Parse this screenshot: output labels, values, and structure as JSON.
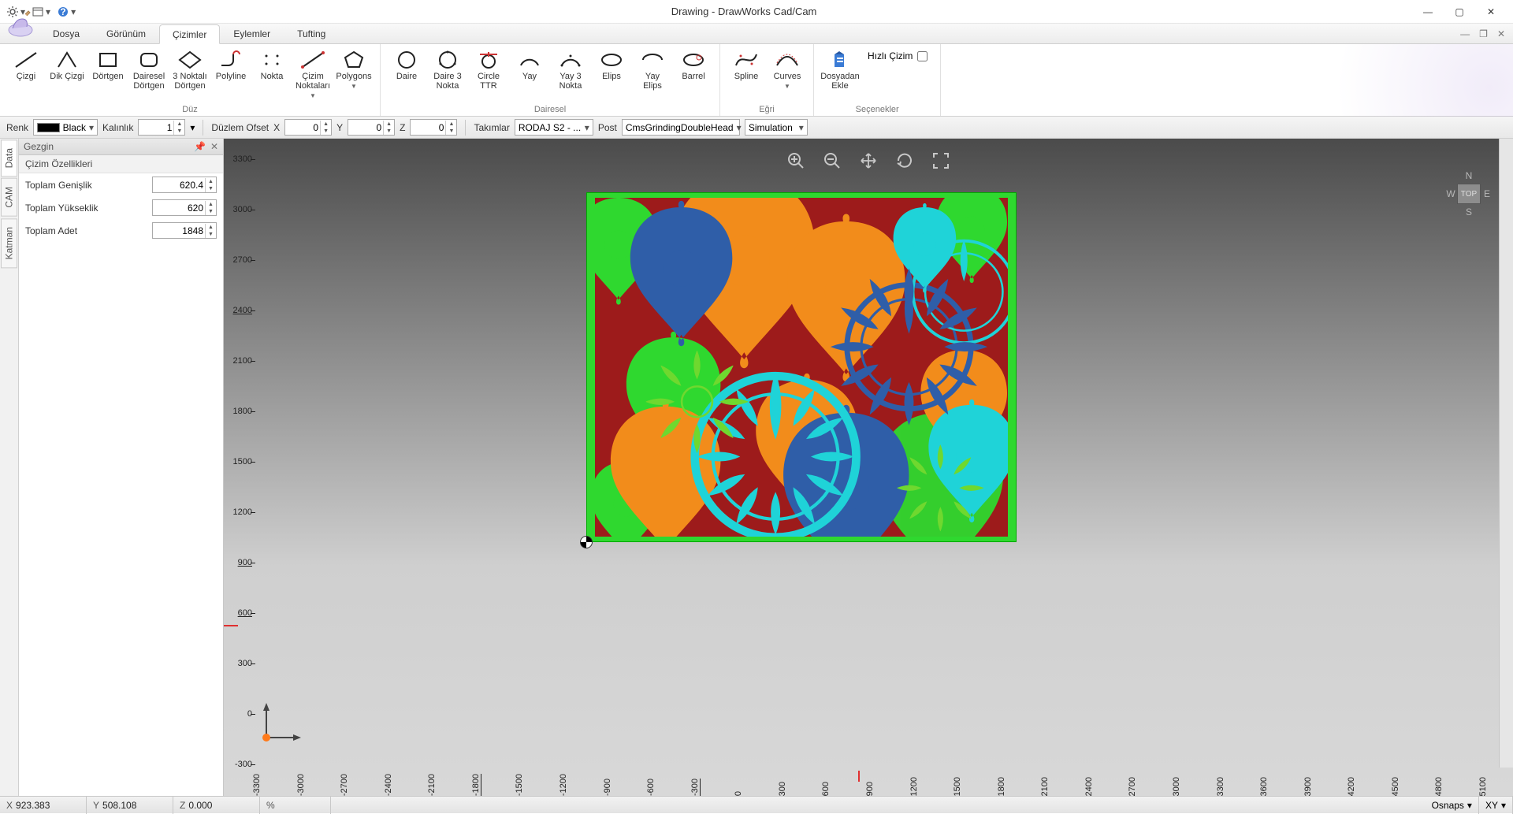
{
  "window": {
    "title": "Drawing - DrawWorks Cad/Cam"
  },
  "menu": {
    "tabs": [
      "Dosya",
      "Görünüm",
      "Çizimler",
      "Eylemler",
      "Tufting"
    ],
    "active": 2
  },
  "ribbon": {
    "groups": [
      {
        "label": "Düz",
        "items": [
          {
            "name": "cizgi",
            "label": "Çizgi"
          },
          {
            "name": "dik-cizgi",
            "label": "Dik Çizgi"
          },
          {
            "name": "dortgen",
            "label": "Dörtgen"
          },
          {
            "name": "dairesel-dortgen",
            "label": "Dairesel\nDörtgen"
          },
          {
            "name": "uc-noktali-dortgen",
            "label": "3 Noktalı\nDörtgen"
          },
          {
            "name": "polyline",
            "label": "Polyline"
          },
          {
            "name": "nokta",
            "label": "Nokta"
          },
          {
            "name": "cizim-noktalari",
            "label": "Çizim\nNoktaları"
          },
          {
            "name": "polygons",
            "label": "Polygons"
          }
        ]
      },
      {
        "label": "Dairesel",
        "items": [
          {
            "name": "daire",
            "label": "Daire"
          },
          {
            "name": "daire-3-nokta",
            "label": "Daire 3\nNokta"
          },
          {
            "name": "circle-ttr",
            "label": "Circle\nTTR"
          },
          {
            "name": "yay",
            "label": "Yay"
          },
          {
            "name": "yay-3-nokta",
            "label": "Yay 3\nNokta"
          },
          {
            "name": "elips",
            "label": "Elips"
          },
          {
            "name": "yay-elips",
            "label": "Yay Elips"
          },
          {
            "name": "barrel",
            "label": "Barrel"
          }
        ]
      },
      {
        "label": "Eğri",
        "items": [
          {
            "name": "spline",
            "label": "Spline"
          },
          {
            "name": "curves",
            "label": "Curves"
          }
        ]
      },
      {
        "label": "Seçenekler",
        "items": [
          {
            "name": "dosyadan-ekle",
            "label": "Dosyadan\nEkle"
          }
        ],
        "extra": {
          "quick": "Hızlı Çizim"
        }
      }
    ]
  },
  "toolbar": {
    "color_label": "Renk",
    "color_value": "Black",
    "thick_label": "Kalınlık",
    "thick_value": "1",
    "plane_label": "Düzlem Ofset",
    "x": "0",
    "y": "0",
    "z": "0",
    "teams_label": "Takımlar",
    "teams_value": "RODAJ S2 - ...",
    "post_label": "Post",
    "post_value": "CmsGrindingDoubleHead",
    "sim_value": "Simulation"
  },
  "gezgin": {
    "title": "Gezgin",
    "tabs": [
      "Data",
      "CAM",
      "Katman"
    ],
    "prop_title": "Çizim Özellikleri",
    "rows": [
      {
        "label": "Toplam Genişlik",
        "value": "620.4"
      },
      {
        "label": "Toplam Yükseklik",
        "value": "620"
      },
      {
        "label": "Toplam Adet",
        "value": "1848"
      }
    ]
  },
  "ruler": {
    "y": [
      3300,
      3000,
      2700,
      2400,
      2100,
      1800,
      1500,
      1200,
      900,
      600,
      300,
      0,
      -300
    ],
    "x": [
      -3300,
      -3000,
      -2700,
      -2400,
      -2100,
      -1800,
      -1500,
      -1200,
      -900,
      -600,
      -300,
      0,
      300,
      600,
      900,
      1200,
      1500,
      1800,
      2100,
      2400,
      2700,
      3000,
      3300,
      3600,
      3900,
      4200,
      4500,
      4800,
      5100
    ]
  },
  "nav": {
    "top": "TOP",
    "n": "N",
    "s": "S",
    "e": "E",
    "w": "W"
  },
  "status": {
    "x_label": "X",
    "x": "923.383",
    "y_label": "Y",
    "y": "508.108",
    "z_label": "Z",
    "z": "0.000",
    "pct_label": "%",
    "osnap": "Osnaps",
    "xy": "XY"
  }
}
